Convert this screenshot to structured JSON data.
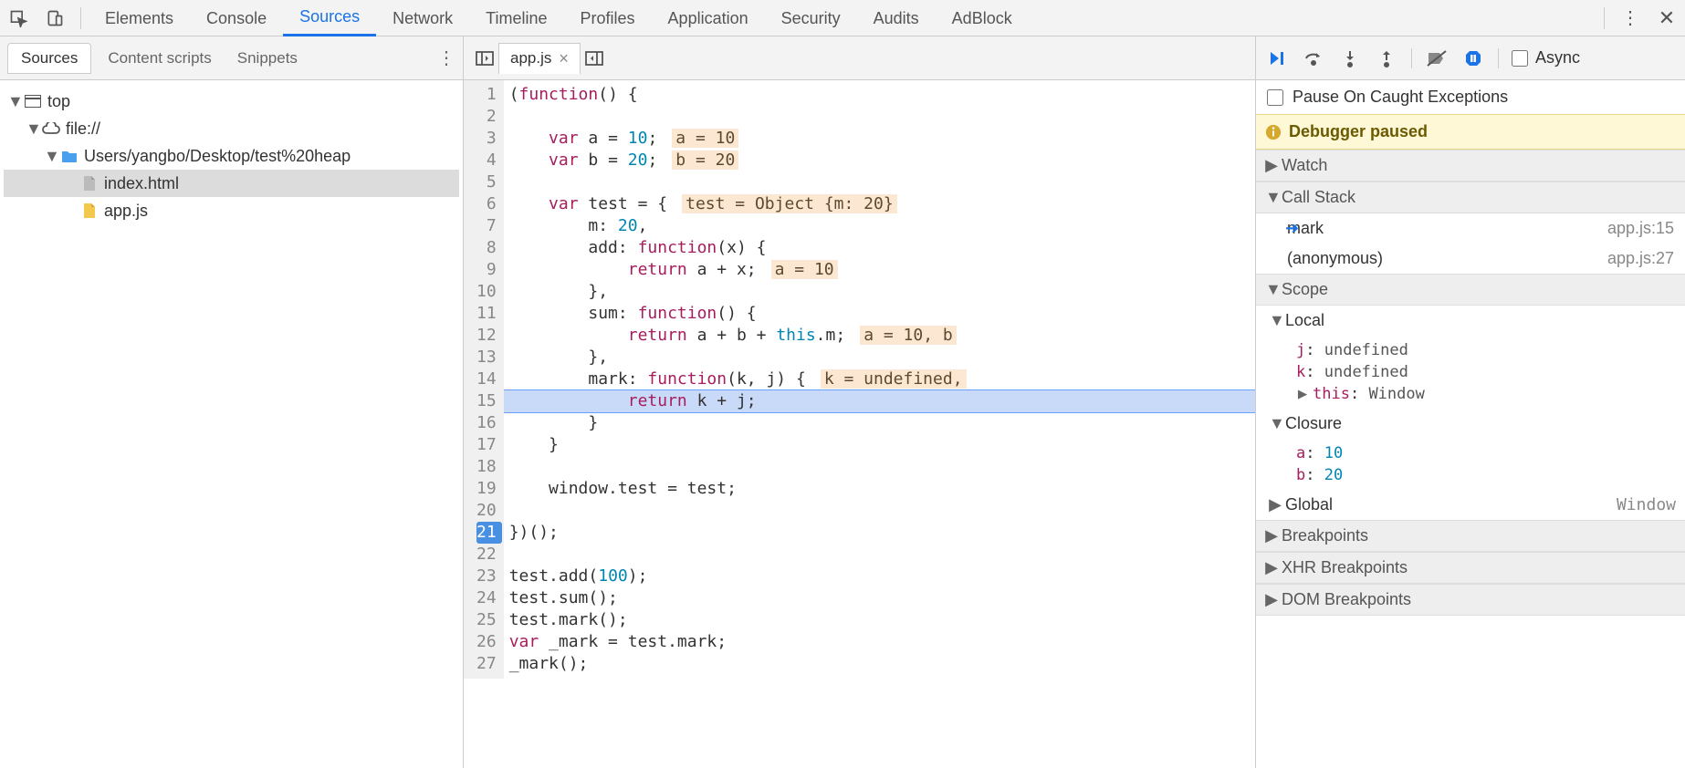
{
  "topTabs": [
    "Elements",
    "Console",
    "Sources",
    "Network",
    "Timeline",
    "Profiles",
    "Application",
    "Security",
    "Audits",
    "AdBlock"
  ],
  "activeTopTab": "Sources",
  "leftTabs": {
    "active": "Sources",
    "others": [
      "Content scripts",
      "Snippets"
    ]
  },
  "tree": {
    "root": "top",
    "origin": "file://",
    "folder": "Users/yangbo/Desktop/test%20heap",
    "files": [
      "index.html",
      "app.js"
    ],
    "selected": "index.html"
  },
  "openFile": "app.js",
  "code": {
    "lines": [
      {
        "n": 1,
        "html": "(<span class='fn'>function</span>() {"
      },
      {
        "n": 2,
        "html": ""
      },
      {
        "n": 3,
        "html": "    <span class='kw'>var</span> a = <span class='num'>10</span>;",
        "ann": "a = 10"
      },
      {
        "n": 4,
        "html": "    <span class='kw'>var</span> b = <span class='num'>20</span>;",
        "ann": "b = 20"
      },
      {
        "n": 5,
        "html": ""
      },
      {
        "n": 6,
        "html": "    <span class='kw'>var</span> test = {",
        "ann": "test = Object {m: 20}"
      },
      {
        "n": 7,
        "html": "        m: <span class='num'>20</span>,"
      },
      {
        "n": 8,
        "html": "        add: <span class='fn'>function</span>(x) {"
      },
      {
        "n": 9,
        "html": "            <span class='kw'>return</span> a + x;",
        "ann": "a = 10"
      },
      {
        "n": 10,
        "html": "        },"
      },
      {
        "n": 11,
        "html": "        sum: <span class='fn'>function</span>() {"
      },
      {
        "n": 12,
        "html": "            <span class='kw'>return</span> a + b + <span class='this'>this</span>.m;",
        "ann": "a = 10, b"
      },
      {
        "n": 13,
        "html": "        },"
      },
      {
        "n": 14,
        "html": "        mark: <span class='fn'>function</span>(k, j) {",
        "ann": "k = undefined,"
      },
      {
        "n": 15,
        "html": "            <span class='kw'>return</span> k + j;",
        "hl": true
      },
      {
        "n": 16,
        "html": "        }"
      },
      {
        "n": 17,
        "html": "    }"
      },
      {
        "n": 18,
        "html": ""
      },
      {
        "n": 19,
        "html": "    window.test = test;"
      },
      {
        "n": 20,
        "html": ""
      },
      {
        "n": 21,
        "html": "})();",
        "bp": true
      },
      {
        "n": 22,
        "html": ""
      },
      {
        "n": 23,
        "html": "test.add(<span class='num'>100</span>);"
      },
      {
        "n": 24,
        "html": "test.sum();"
      },
      {
        "n": 25,
        "html": "test.mark();"
      },
      {
        "n": 26,
        "html": "<span class='kw'>var</span> _mark = test.mark;"
      },
      {
        "n": 27,
        "html": "_mark();"
      }
    ]
  },
  "debugger": {
    "asyncLabel": "Async",
    "pauseExceptionsLabel": "Pause On Caught Exceptions",
    "status": "Debugger paused",
    "sections": {
      "watch": "Watch",
      "callStack": "Call Stack",
      "scope": "Scope",
      "breakpoints": "Breakpoints",
      "xhr": "XHR Breakpoints",
      "dom": "DOM Breakpoints"
    },
    "callStack": [
      {
        "name": "mark",
        "loc": "app.js:15",
        "current": true
      },
      {
        "name": "(anonymous)",
        "loc": "app.js:27"
      }
    ],
    "scope": {
      "local": {
        "label": "Local",
        "vars": [
          {
            "k": "j",
            "v": "undefined"
          },
          {
            "k": "k",
            "v": "undefined"
          }
        ],
        "this": "Window"
      },
      "closure": {
        "label": "Closure",
        "vars": [
          {
            "k": "a",
            "v": "10"
          },
          {
            "k": "b",
            "v": "20"
          }
        ]
      },
      "global": {
        "label": "Global",
        "val": "Window"
      }
    }
  }
}
